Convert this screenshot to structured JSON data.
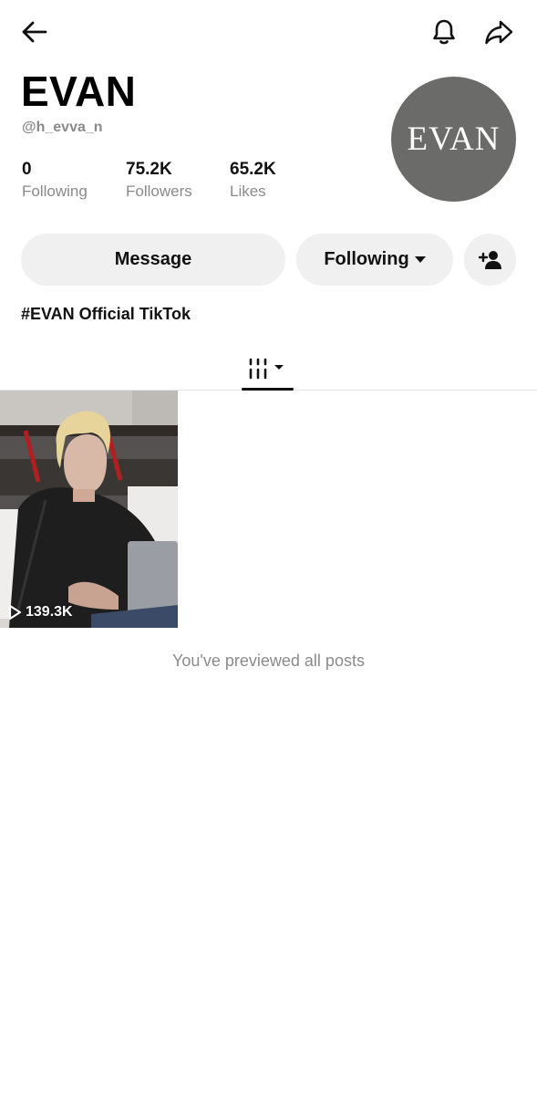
{
  "profile": {
    "display_name": "EVAN",
    "handle": "@h_evva_n",
    "avatar_text": "EVAN",
    "bio": "#EVAN Official TikTok"
  },
  "stats": {
    "following_count": "0",
    "following_label": "Following",
    "followers_count": "75.2K",
    "followers_label": "Followers",
    "likes_count": "65.2K",
    "likes_label": "Likes"
  },
  "actions": {
    "message_label": "Message",
    "following_label": "Following"
  },
  "icons": {
    "back": "back-arrow-icon",
    "notifications": "bell-icon",
    "share": "share-icon",
    "add_friend": "add-user-icon",
    "videos_tab": "grid-icon",
    "play": "play-icon"
  },
  "posts": [
    {
      "views": "139.3K"
    }
  ],
  "end_message": "You've previewed all posts",
  "colors": {
    "button_bg": "#f0f0f0",
    "muted_text": "#8a8a8a",
    "avatar_bg": "#6b6b69"
  }
}
